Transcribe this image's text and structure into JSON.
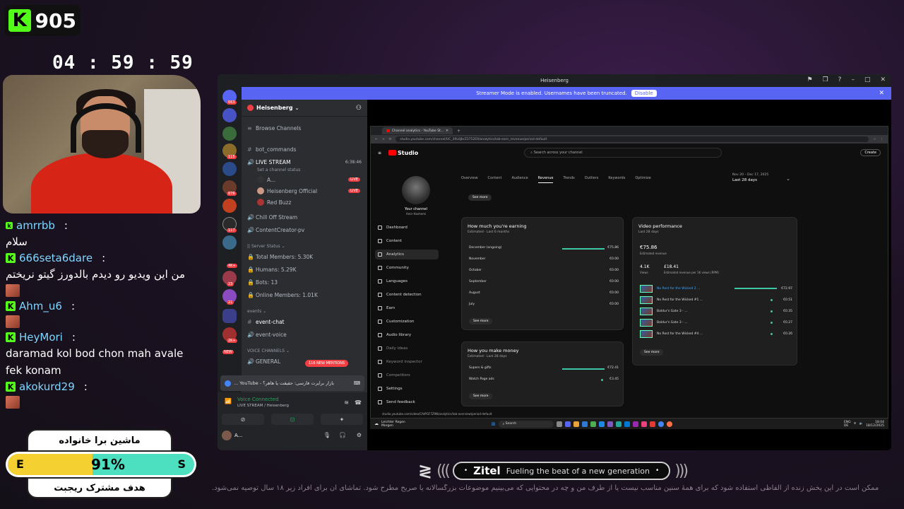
{
  "kick": {
    "count": "905",
    "logo_letter": "K"
  },
  "timer": "04 : 59 : 59",
  "chat": [
    {
      "user": "amrrbb",
      "badge": "k",
      "message": "سلام",
      "rtl": true
    },
    {
      "user": "666seta6dare",
      "badge": "K",
      "message": "من این ویدیو رو دیدم بالدورز گیتو نریختم",
      "rtl": true,
      "emote_after": true
    },
    {
      "user": "Ahm_u6",
      "badge": "K",
      "message": "",
      "emote_after": true
    },
    {
      "user": "HeyMori",
      "badge": "K",
      "message": "daramad kol bod chon mah avale fek konam",
      "rtl": false
    },
    {
      "user": "akokurd29",
      "badge": "K",
      "message": "",
      "emote_after": true
    }
  ],
  "goal": {
    "top_text": "ماشین برا خانواده",
    "left_label": "E",
    "right_label": "S",
    "percent": 0.91,
    "percent_label": "91%",
    "bottom_text": "هدف مشترک ریجبت"
  },
  "discord": {
    "window_title": "Heisenberg",
    "streamer_bar": "Streamer Mode is enabled. Usernames have been truncated.",
    "disable_label": "Disable",
    "server_name": "Heisenberg",
    "browse": "Browse Channels",
    "channels": {
      "bot_commands": "bot_commands",
      "live_stream": "LIVE STREAM",
      "live_time": "6:38:46",
      "set_status": "Set a channel status",
      "member1": "A...",
      "member2": "Heisenberg Official",
      "member3": "Red Buzz",
      "chill": "Chill Off Stream",
      "creator": "ContentCreator-pv",
      "server_status": "|| Server Status",
      "total": "Total Members: 5.30K",
      "humans": "Humans: 5.29K",
      "bots": "Bots: 13",
      "online": "Online Members: 1.01K",
      "events_cat": "events",
      "event_chat": "event-chat",
      "event_voice": "event-voice",
      "voice_cat": "VOICE CHANNELS",
      "general": "GENERAL",
      "mention": "116 NEW MENTIONS"
    },
    "live_tag": "LIVE",
    "yt_chip": "بازار برایرت فارسی: حقیقت یا هاهر؟ - YouTube ...",
    "voice_connected": "Voice Connected",
    "voice_sub": "LIVE STREAM / Heisenberg",
    "user_name": "A...",
    "rail_badges": [
      "663",
      "115",
      "876",
      "117",
      "4K+",
      "23",
      "21",
      "2K+"
    ],
    "new_label": "NEW"
  },
  "youtube": {
    "tab_title": "Channel analytics - YouTube St...",
    "url": "studio.youtube.com/channel/UC_39L6JbrZ3752E9/analytics/tab-earn_revenue/period-default",
    "search_placeholder": "Search across your channel",
    "create": "Create",
    "studio": "Studio",
    "channel_label": "Your channel",
    "channel_name": "Amir Hashemi",
    "nav": [
      "Dashboard",
      "Content",
      "Analytics",
      "Community",
      "Languages",
      "Content detection",
      "Earn",
      "Customization",
      "Audio library",
      "Daily ideas",
      "Keyword inspector",
      "Competitors",
      "Settings",
      "Send feedback"
    ],
    "tabs": [
      "Overview",
      "Content",
      "Audience",
      "Revenue",
      "Trends",
      "Outliers",
      "Keywords",
      "Optimize"
    ],
    "date_small": "Nov 20 – Dec 17, 2025",
    "date_main": "Last 28 days",
    "see_more": "See more",
    "earning": {
      "title": "How much you're earning",
      "sub": "Estimated · Last 6 months",
      "rows": [
        {
          "label": "December (ongoing)",
          "value": "€75.86",
          "bar": 1
        },
        {
          "label": "November",
          "value": "€0.00"
        },
        {
          "label": "October",
          "value": "€0.00"
        },
        {
          "label": "September",
          "value": "€0.00"
        },
        {
          "label": "August",
          "value": "€0.00"
        },
        {
          "label": "July",
          "value": "€0.00"
        }
      ]
    },
    "money": {
      "title": "How you make money",
      "sub": "Estimated · Last 28 days",
      "rows": [
        {
          "label": "Supers & gifts",
          "value": "€72.41",
          "bar": 1
        },
        {
          "label": "Watch Page ads",
          "value": "€3.45"
        }
      ]
    },
    "video_perf": {
      "title": "Video performance",
      "sub": "Last 28 days",
      "total": "€75.86",
      "total_label": "Estimated revenue",
      "views": "4.1K",
      "views_label": "Views",
      "rpm": "£18.41",
      "rpm_label": "Estimated revenue per 1K views (RPM)",
      "videos": [
        {
          "title": "No Rest for the Wicked 2 ...",
          "value": "€72.97",
          "bar": 1
        },
        {
          "title": "No Rest for the Wicked #1 ...",
          "value": "€0.51"
        },
        {
          "title": "Baldur's Gate 3 - ...",
          "value": "€0.35"
        },
        {
          "title": "Baldur's Gate 3 - ...",
          "value": "€0.27"
        },
        {
          "title": "No Rest for the Wicked #4 ...",
          "value": "€0.26"
        }
      ]
    },
    "status_url": "studio.youtube.com/video/CAtPGF7Z9N/analytics/tab-overview/period-default",
    "taskbar": {
      "weather": "Leichter Regen",
      "weather_sub": "Morgen",
      "search": "Search",
      "lang": "ENG",
      "region": "DE",
      "time": "18:04",
      "date": "18/12/2025"
    }
  },
  "sponsor": {
    "name": "Zitel",
    "tagline": "Fueling the beat of a new generation"
  },
  "disclaimer": "ممکن است در این پخش زنده از الفاظی استفاده شود که برای همهٔ سنین مناسب نیست یا از طرف من و چه در محتوایی که می‌بینیم موضوعات بزرگسالانه یا صریح مطرح شود. تماشای آن برای افراد زیر ۱۸ سال توصیه نمی‌شود."
}
